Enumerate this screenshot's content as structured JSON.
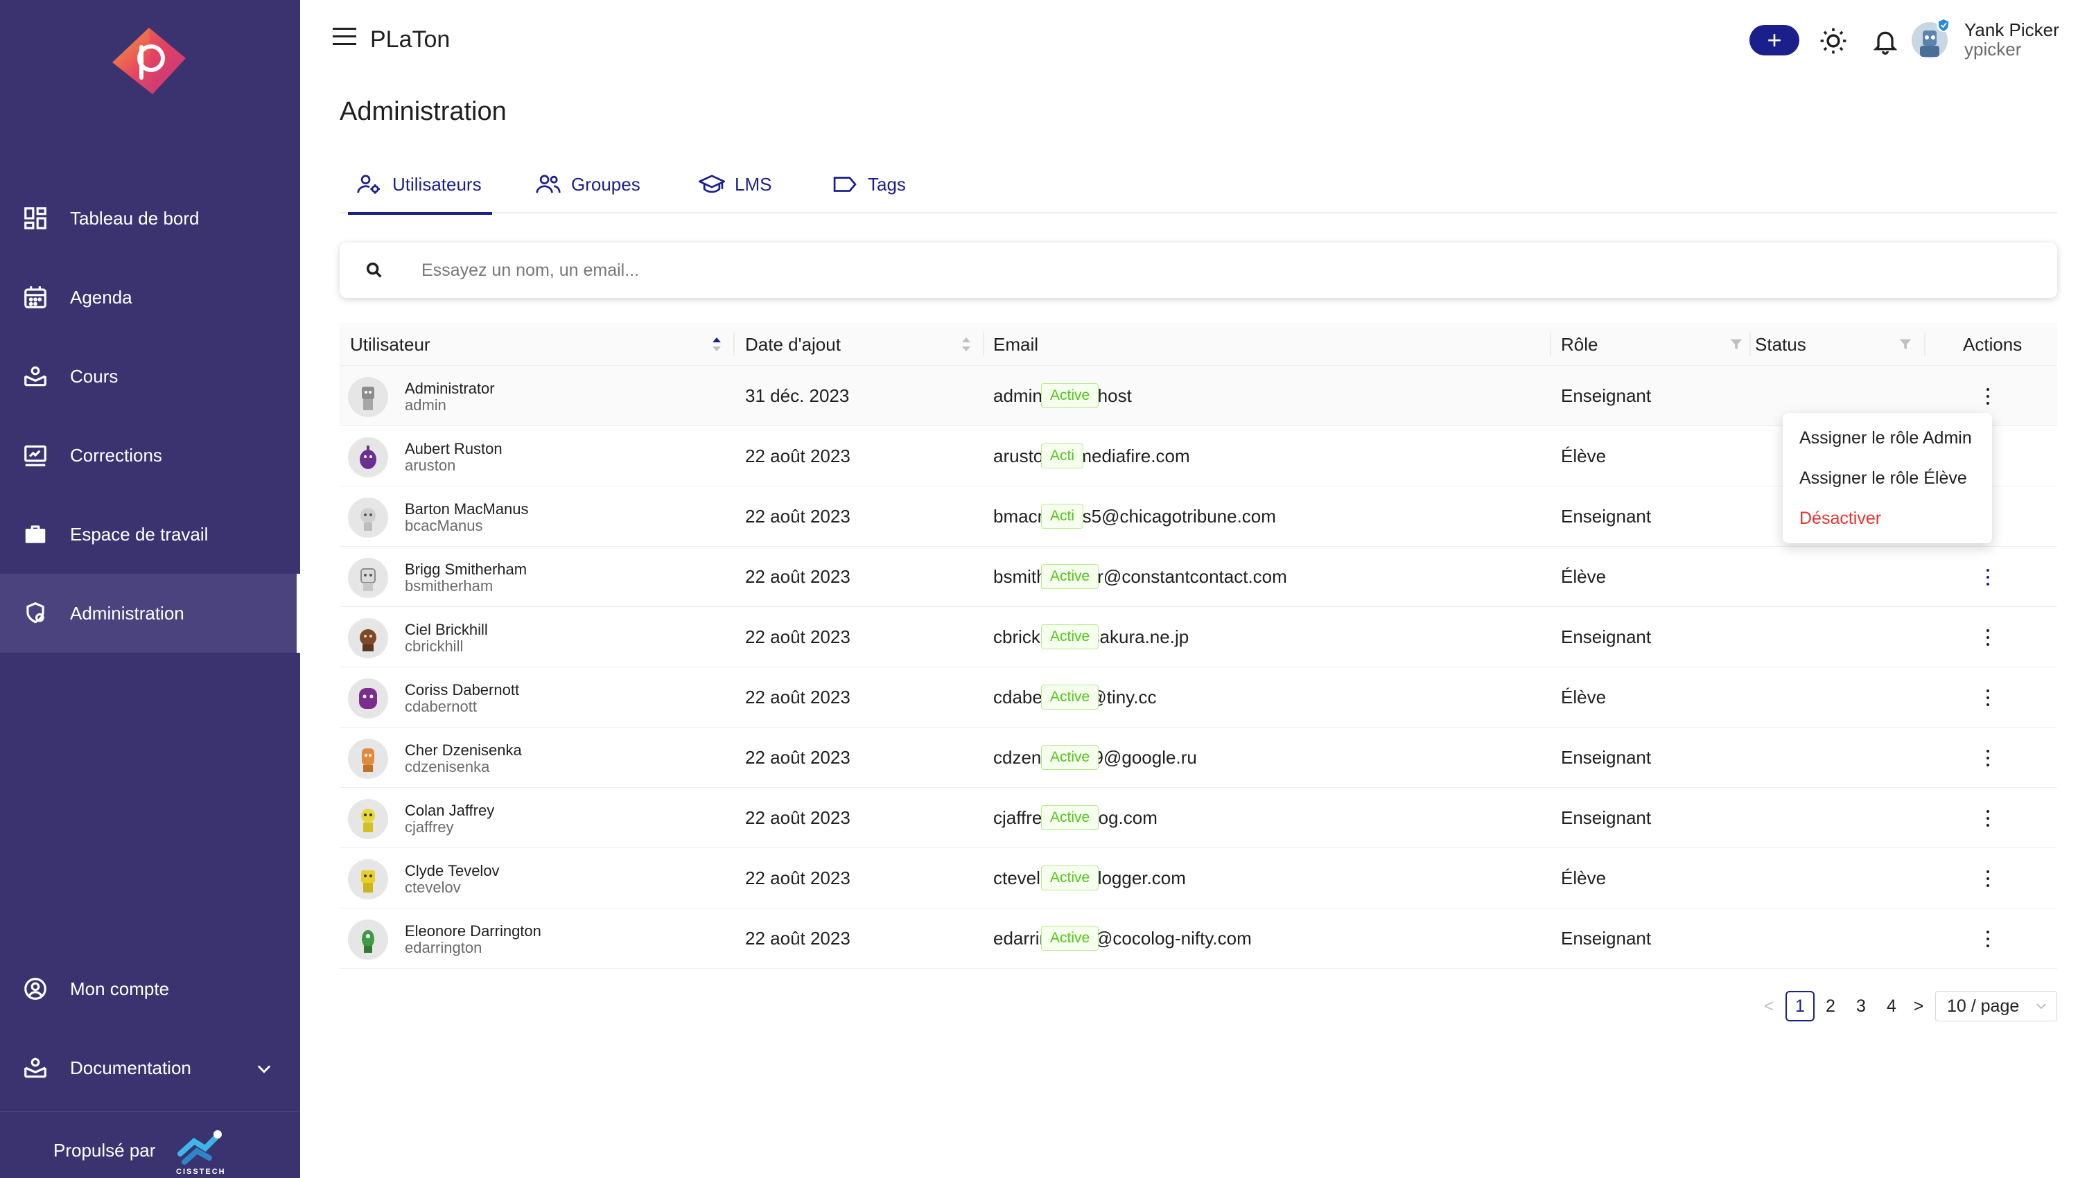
{
  "app": {
    "title": "PLaTon"
  },
  "sidebar": {
    "items": [
      {
        "label": "Tableau de bord",
        "icon": "dashboard-icon"
      },
      {
        "label": "Agenda",
        "icon": "calendar-icon"
      },
      {
        "label": "Cours",
        "icon": "courses-icon"
      },
      {
        "label": "Corrections",
        "icon": "corrections-icon"
      },
      {
        "label": "Espace de travail",
        "icon": "briefcase-icon"
      },
      {
        "label": "Administration",
        "icon": "admin-icon",
        "active": true
      }
    ],
    "bottom": [
      {
        "label": "Mon compte",
        "icon": "account-icon"
      },
      {
        "label": "Documentation",
        "icon": "documentation-icon"
      }
    ],
    "footer": {
      "powered_by": "Propulsé par",
      "brand": "CISSTECH"
    }
  },
  "header": {
    "user_name": "Yank Picker",
    "user_login": "ypicker",
    "plus_label": "+"
  },
  "page": {
    "title": "Administration"
  },
  "tabs": [
    {
      "label": "Utilisateurs",
      "active": true
    },
    {
      "label": "Groupes"
    },
    {
      "label": "LMS"
    },
    {
      "label": "Tags"
    }
  ],
  "search": {
    "placeholder": "Essayez un nom, un email...",
    "value": ""
  },
  "table": {
    "columns": {
      "user": "Utilisateur",
      "date": "Date d'ajout",
      "email": "Email",
      "role": "Rôle",
      "status": "Status",
      "actions": "Actions"
    },
    "rows": [
      {
        "name": "Administrator",
        "login": "admin",
        "date": "31 déc. 2023",
        "email": "admin@localhost",
        "role": "Enseignant",
        "status": "Active"
      },
      {
        "name": "Aubert Ruston",
        "login": "aruston",
        "date": "22 août 2023",
        "email": "arustonf@mediafire.com",
        "role": "Élève",
        "status": "Acti"
      },
      {
        "name": "Barton MacManus",
        "login": "bcacManus",
        "date": "22 août 2023",
        "email": "bmacmanus5@chicagotribune.com",
        "role": "Enseignant",
        "status": "Acti"
      },
      {
        "name": "Brigg Smitherham",
        "login": "bsmitherham",
        "date": "22 août 2023",
        "email": "bsmitherhamr@constantcontact.com",
        "role": "Élève",
        "status": "Active"
      },
      {
        "name": "Ciel Brickhill",
        "login": "cbrickhill",
        "date": "22 août 2023",
        "email": "cbrickhilla@sakura.ne.jp",
        "role": "Enseignant",
        "status": "Active"
      },
      {
        "name": "Coriss Dabernott",
        "login": "cdabernott",
        "date": "22 août 2023",
        "email": "cdabernotth@tiny.cc",
        "role": "Élève",
        "status": "Active"
      },
      {
        "name": "Cher Dzenisenka",
        "login": "cdzenisenka",
        "date": "22 août 2023",
        "email": "cdzenisenka9@google.ru",
        "role": "Enseignant",
        "status": "Active"
      },
      {
        "name": "Colan Jaffrey",
        "login": "cjaffrey",
        "date": "22 août 2023",
        "email": "cjaffreym@blog.com",
        "role": "Enseignant",
        "status": "Active"
      },
      {
        "name": "Clyde Tevelov",
        "login": "ctevelov",
        "date": "22 août 2023",
        "email": "ctevelovd@blogger.com",
        "role": "Élève",
        "status": "Active"
      },
      {
        "name": "Eleonore Darrington",
        "login": "edarrington",
        "date": "22 août 2023",
        "email": "edarringtono@cocolog-nifty.com",
        "role": "Enseignant",
        "status": "Active"
      }
    ]
  },
  "dropdown": {
    "items": [
      {
        "label": "Assigner le rôle Admin"
      },
      {
        "label": "Assigner le rôle Élève"
      },
      {
        "label": "Désactiver",
        "danger": true
      }
    ]
  },
  "pagination": {
    "pages": [
      "1",
      "2",
      "3",
      "4"
    ],
    "current": "1",
    "prev": "<",
    "next": ">",
    "page_size": "10 / page"
  },
  "colors": {
    "sidebar_bg": "#3a3370",
    "accent": "#1a1f8c",
    "status_green": "#52c41a",
    "danger": "#e5342f"
  }
}
